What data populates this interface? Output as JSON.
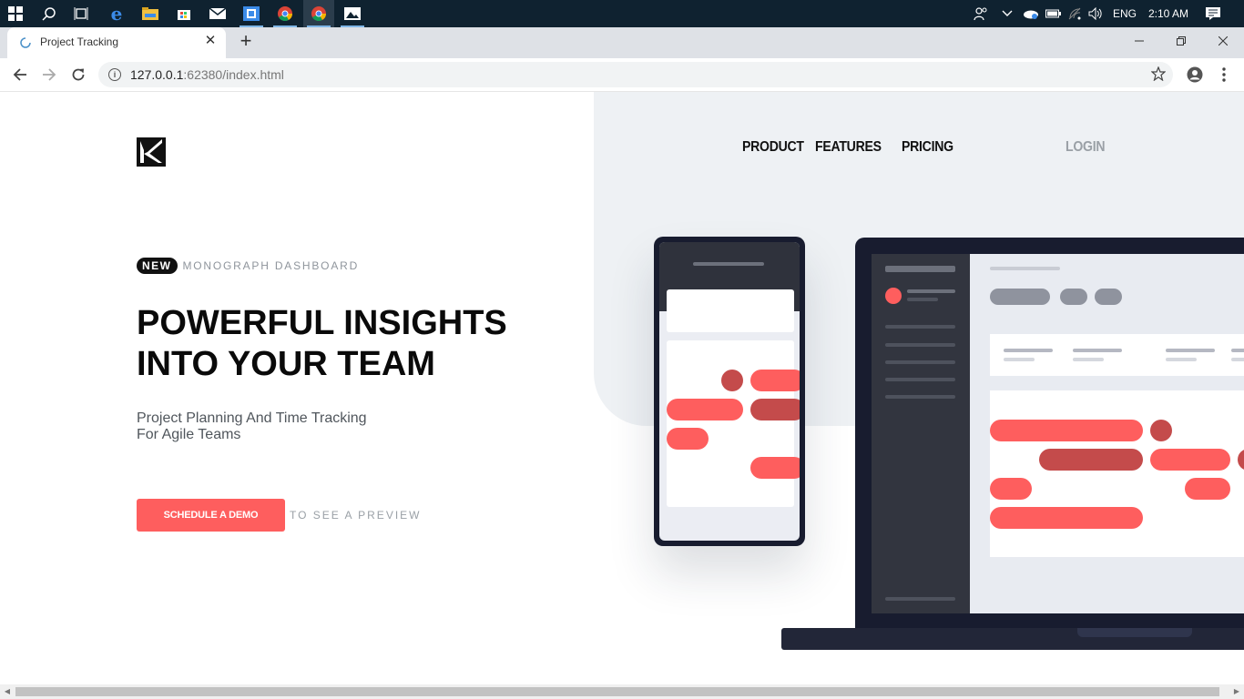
{
  "taskbar": {
    "apps": [
      "start-icon",
      "search-icon",
      "task-view-icon",
      "edge-icon",
      "file-explorer-icon",
      "store-icon",
      "mail-icon",
      "app-icon",
      "chrome-icon",
      "chrome-icon",
      "photos-icon"
    ],
    "language": "ENG",
    "time": "2:10 AM"
  },
  "browser": {
    "tab_title": "Project Tracking",
    "url_host": "127.0.0.1",
    "url_path": ":62380/index.html"
  },
  "nav": {
    "items": [
      "PRODUCT",
      "FEATURES",
      "PRICING"
    ],
    "login": "LOGIN"
  },
  "hero": {
    "badge": "NEW",
    "badge_text": "MONOGRAPH DASHBOARD",
    "headline_line1": "POWERFUL INSIGHTS",
    "headline_line2": "INTO YOUR TEAM",
    "subhead_line1": "Project Planning And Time Tracking",
    "subhead_line2": "For Agile Teams",
    "cta": "SCHEDULE A DEMO",
    "cta_hint": "TO SEE A PREVIEW"
  },
  "colors": {
    "accent": "#fe5e5e",
    "accent_dark": "#c44b4b",
    "device_frame": "#181c2f",
    "hero_bg": "#eef1f4"
  }
}
